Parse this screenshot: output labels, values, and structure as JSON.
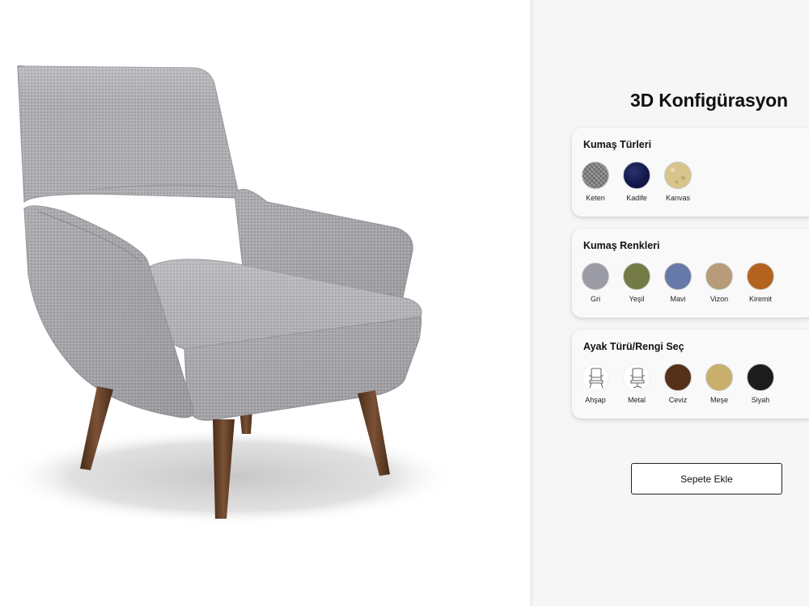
{
  "panel": {
    "title": "3D Konfigürasyon"
  },
  "sections": [
    {
      "title": "Kumaş Türleri",
      "options": [
        {
          "label": "Keten",
          "icon": "linen-texture-swatch",
          "color": "#7f7f7f"
        },
        {
          "label": "Kadife",
          "icon": "velvet-texture-swatch",
          "color": "#12184a"
        },
        {
          "label": "Kanvas",
          "icon": "canvas-texture-swatch",
          "color": "#d8c58c"
        }
      ]
    },
    {
      "title": "Kumaş Renkleri",
      "options": [
        {
          "label": "Gri",
          "color": "#9b9ba6"
        },
        {
          "label": "Yeşil",
          "color": "#747a45"
        },
        {
          "label": "Mavi",
          "color": "#6679a8"
        },
        {
          "label": "Vizon",
          "color": "#b89b78"
        },
        {
          "label": "Kiremit",
          "color": "#b4631e"
        }
      ]
    },
    {
      "title": "Ayak Türü/Rengi Seç",
      "options": [
        {
          "label": "Ahşap",
          "icon": "wooden-leg-chair-icon"
        },
        {
          "label": "Metal",
          "icon": "metal-base-chair-icon"
        },
        {
          "label": "Ceviz",
          "color": "#55301a"
        },
        {
          "label": "Meşe",
          "color": "#c8b06c"
        },
        {
          "label": "Siyah",
          "color": "#1c1c1c"
        }
      ]
    }
  ],
  "cart_button": {
    "label": "Sepete Ekle"
  },
  "viewer": {
    "fabric_color": "#a9a9ae",
    "leg_color": "#5e3b24"
  }
}
